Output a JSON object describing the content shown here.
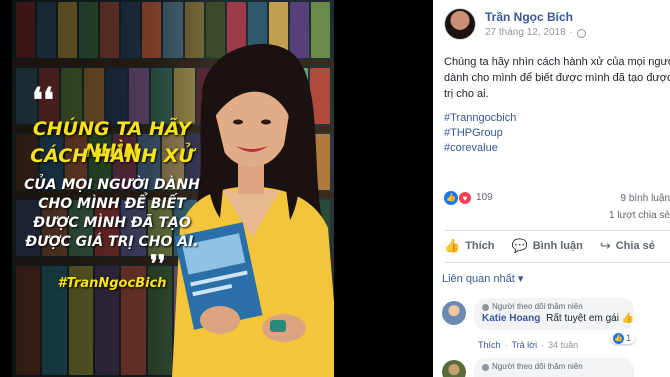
{
  "image_quote": {
    "open_mark": "❛❛",
    "line1": "CHÚNG TA HÃY NHÌN",
    "line2": "CÁCH HÀNH XỬ",
    "line3": "CỦA MỌI NGƯỜI DÀNH",
    "line4": "CHO MÌNH ĐỂ BIẾT",
    "line5": "ĐƯỢC MÌNH ĐÃ TẠO",
    "line6": "ĐƯỢC GIÁ TRỊ CHO AI.",
    "close_mark": "❜❜",
    "hashtag": "#TranNgocBich"
  },
  "post": {
    "author": "Trần Ngọc Bích",
    "date": "27 tháng 12, 2018",
    "date_separator": "·",
    "text_lines": [
      "Chúng ta hãy nhìn cách hành xử của mọi người",
      "dành cho mình để biết được mình đã tạo được giá",
      "trị cho ai."
    ],
    "hashtags": [
      "#Tranngocbich",
      "#THPGroup",
      "#corevalue"
    ],
    "reaction_count": "109",
    "shares_text": "9 bình luận",
    "comments_text": "1 lượt chia sẻ",
    "actions": {
      "like": "Thích",
      "comment": "Bình luận",
      "share": "Chia sẻ"
    },
    "comment_filter": "Liên quan nhất",
    "comments": [
      {
        "badge": "Người theo dõi thâm niên",
        "name": "Katie Hoang",
        "text": "Rất tuyệt em gái",
        "emoji": "👍",
        "react_count": "1",
        "like_label": "Thích",
        "reply_label": "Trả lời",
        "age": "34 tuần",
        "sep": "·"
      },
      {
        "badge": "Người theo dõi thâm niên"
      }
    ]
  },
  "colors": {
    "link": "#385898",
    "quote_yellow": "#f7e21b",
    "like_blue": "#1877f2",
    "love_red": "#f33e58"
  },
  "icons": [
    "globe-icon",
    "like-icon",
    "love-icon",
    "comment-icon",
    "share-icon",
    "chevron-down-icon",
    "badge-icon"
  ]
}
